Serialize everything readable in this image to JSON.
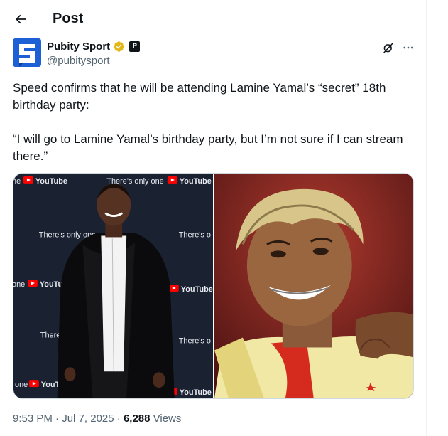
{
  "header": {
    "title": "Post"
  },
  "author": {
    "name": "Pubity Sport",
    "handle": "@pubitysport",
    "avatar_letter": "S",
    "affiliate_mark": "P"
  },
  "tweet": {
    "line1": "Speed confirms that he will be attending Lamine Yamal’s “secret” 18th birthday party:",
    "line2": "“I will go to Lamine Yamal’s birthday party, but I’m not sure if I can stream there.”"
  },
  "media": {
    "left_backdrop_text": [
      "There's only one",
      "YouTube"
    ],
    "left_photo": "man in black jacket on YouTube step-and-repeat backdrop",
    "right_photo": "smiling young footballer with bleached curly hair in yellow kit"
  },
  "meta": {
    "time": "9:53 PM",
    "separator": "·",
    "date": "Jul 7, 2025",
    "views_count": "6,288",
    "views_label": "Views"
  },
  "colors": {
    "text": "#0f1419",
    "secondary": "#536471",
    "brand_blue": "#1d5fd4",
    "verified_gold": "#e2b719",
    "youtube_red": "#ff0000"
  },
  "icons": [
    "back-arrow-icon",
    "verified-badge-icon",
    "affiliate-icon",
    "grok-icon",
    "more-icon"
  ]
}
